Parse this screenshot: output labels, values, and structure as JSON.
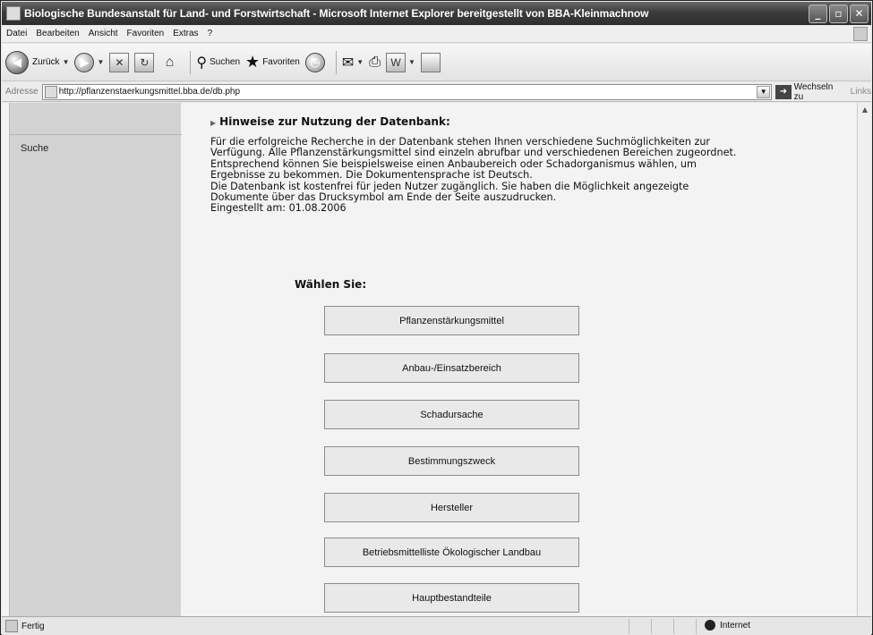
{
  "window": {
    "title": "Biologische Bundesanstalt für Land- und Forstwirtschaft - Microsoft Internet Explorer bereitgestellt von BBA-Kleinmachnow"
  },
  "menu": [
    "Datei",
    "Bearbeiten",
    "Ansicht",
    "Favoriten",
    "Extras",
    "?"
  ],
  "toolbar": {
    "back_label": "Zurück",
    "search_label": "Suchen",
    "favorites_label": "Favoriten"
  },
  "address": {
    "label": "Adresse",
    "url": "http://pflanzenstaerkungsmittel.bba.de/db.php",
    "go_label": "Wechseln zu",
    "links_label": "Links"
  },
  "sidebar": {
    "items": [
      "Suche"
    ]
  },
  "main": {
    "heading": "Hinweise zur Nutzung der Datenbank:",
    "info_lines": [
      "Für die erfolgreiche Recherche in der Datenbank stehen Ihnen verschiedene Suchmöglichkeiten zur",
      "Verfügung. Alle Pflanzenstärkungsmittel sind einzeln abrufbar und verschiedenen Bereichen zugeordnet.",
      "Entsprechend können Sie beispielsweise einen Anbaubereich oder Schadorganismus wählen, um",
      "Ergebnisse zu bekommen. Die Dokumentensprache ist Deutsch.",
      "Die Datenbank ist kostenfrei für jeden Nutzer zugänglich. Sie haben die Möglichkeit angezeigte",
      "Dokumente über das Drucksymbol am Ende der Seite auszudrucken.",
      "Eingestellt am: 01.08.2006"
    ],
    "choose_label": "Wählen Sie:",
    "choices": [
      "Pflanzenstärkungsmittel",
      "Anbau-/Einsatzbereich",
      "Schadursache",
      "Bestimmungszweck",
      "Hersteller",
      "Betriebsmittelliste Ökologischer Landbau",
      "Hauptbestandteile"
    ]
  },
  "status": {
    "text": "Fertig",
    "zone": "Internet"
  }
}
